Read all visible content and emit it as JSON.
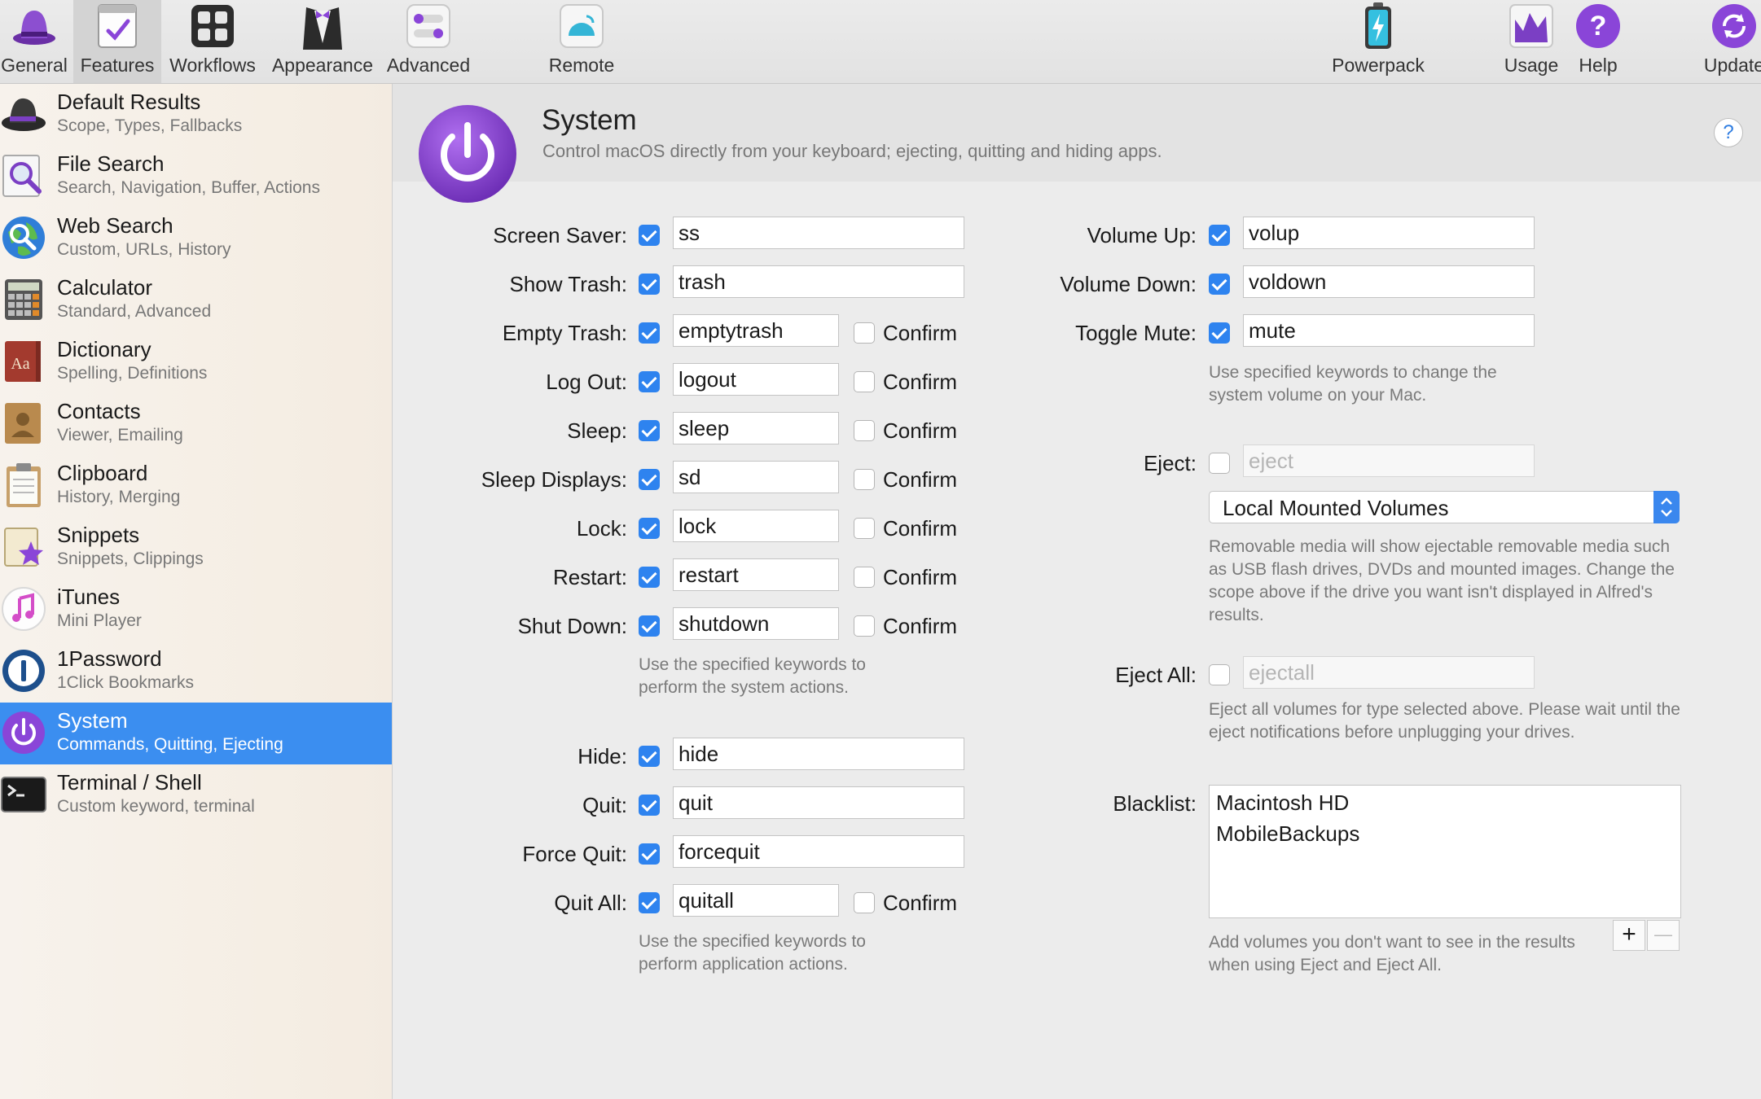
{
  "toolbar": {
    "items": [
      {
        "label": "General",
        "icon": "hat-icon"
      },
      {
        "label": "Features",
        "icon": "checklist-icon",
        "selected": true
      },
      {
        "label": "Workflows",
        "icon": "workflows-icon"
      },
      {
        "label": "Appearance",
        "icon": "tuxedo-icon"
      },
      {
        "label": "Advanced",
        "icon": "toggles-icon"
      },
      {
        "label": "Remote",
        "icon": "remote-icon"
      },
      {
        "label": "Powerpack",
        "icon": "battery-icon"
      },
      {
        "label": "Usage",
        "icon": "usage-graph-icon"
      },
      {
        "label": "Help",
        "icon": "help-icon"
      },
      {
        "label": "Update",
        "icon": "update-icon"
      }
    ]
  },
  "sidebar": {
    "items": [
      {
        "title": "Default Results",
        "subtitle": "Scope, Types, Fallbacks"
      },
      {
        "title": "File Search",
        "subtitle": "Search, Navigation, Buffer, Actions"
      },
      {
        "title": "Web Search",
        "subtitle": "Custom, URLs, History"
      },
      {
        "title": "Calculator",
        "subtitle": "Standard, Advanced"
      },
      {
        "title": "Dictionary",
        "subtitle": "Spelling, Definitions"
      },
      {
        "title": "Contacts",
        "subtitle": "Viewer, Emailing"
      },
      {
        "title": "Clipboard",
        "subtitle": "History, Merging"
      },
      {
        "title": "Snippets",
        "subtitle": "Snippets, Clippings"
      },
      {
        "title": "iTunes",
        "subtitle": "Mini Player"
      },
      {
        "title": "1Password",
        "subtitle": "1Click Bookmarks"
      },
      {
        "title": "System",
        "subtitle": "Commands, Quitting, Ejecting",
        "selected": true
      },
      {
        "title": "Terminal / Shell",
        "subtitle": "Custom keyword, terminal"
      }
    ]
  },
  "header": {
    "title": "System",
    "description": "Control macOS directly from your keyboard; ejecting, quitting and hiding apps.",
    "help_label": "?"
  },
  "system_actions": {
    "rows": [
      {
        "label": "Screen Saver:",
        "keyword": "ss",
        "enabled": true
      },
      {
        "label": "Show Trash:",
        "keyword": "trash",
        "enabled": true
      },
      {
        "label": "Empty Trash:",
        "keyword": "emptytrash",
        "enabled": true,
        "confirm": false
      },
      {
        "label": "Log Out:",
        "keyword": "logout",
        "enabled": true,
        "confirm": false
      },
      {
        "label": "Sleep:",
        "keyword": "sleep",
        "enabled": true,
        "confirm": false
      },
      {
        "label": "Sleep Displays:",
        "keyword": "sd",
        "enabled": true,
        "confirm": false
      },
      {
        "label": "Lock:",
        "keyword": "lock",
        "enabled": true,
        "confirm": false
      },
      {
        "label": "Restart:",
        "keyword": "restart",
        "enabled": true,
        "confirm": false
      },
      {
        "label": "Shut Down:",
        "keyword": "shutdown",
        "enabled": true,
        "confirm": false
      }
    ],
    "confirm_label": "Confirm",
    "help": "Use the specified keywords to perform the system actions."
  },
  "app_actions": {
    "rows": [
      {
        "label": "Hide:",
        "keyword": "hide",
        "enabled": true
      },
      {
        "label": "Quit:",
        "keyword": "quit",
        "enabled": true
      },
      {
        "label": "Force Quit:",
        "keyword": "forcequit",
        "enabled": true
      },
      {
        "label": "Quit All:",
        "keyword": "quitall",
        "enabled": true,
        "confirm": false
      }
    ],
    "help": "Use the specified keywords to perform application actions."
  },
  "volume": {
    "rows": [
      {
        "label": "Volume Up:",
        "keyword": "volup",
        "enabled": true
      },
      {
        "label": "Volume Down:",
        "keyword": "voldown",
        "enabled": true
      },
      {
        "label": "Toggle Mute:",
        "keyword": "mute",
        "enabled": true
      }
    ],
    "help": "Use specified keywords to change the system volume on your Mac."
  },
  "eject": {
    "label": "Eject:",
    "placeholder": "eject",
    "enabled": false,
    "scope_selected": "Local Mounted Volumes",
    "help": "Removable media will show ejectable removable media such as USB flash drives, DVDs and mounted images. Change the scope above if the drive you want isn't displayed in Alfred's results."
  },
  "eject_all": {
    "label": "Eject All:",
    "placeholder": "ejectall",
    "enabled": false,
    "help": "Eject all volumes for type selected above. Please wait until the eject notifications before unplugging your drives."
  },
  "blacklist": {
    "label": "Blacklist:",
    "items": [
      "Macintosh HD",
      "MobileBackups"
    ],
    "add_label": "+",
    "remove_label": "—",
    "help": "Add volumes you don't want to see in the results when using Eject and Eject All."
  },
  "colors": {
    "accent": "#2e83ef",
    "selection": "#3b8ef0",
    "alfred_purple": "#8e44d6"
  }
}
